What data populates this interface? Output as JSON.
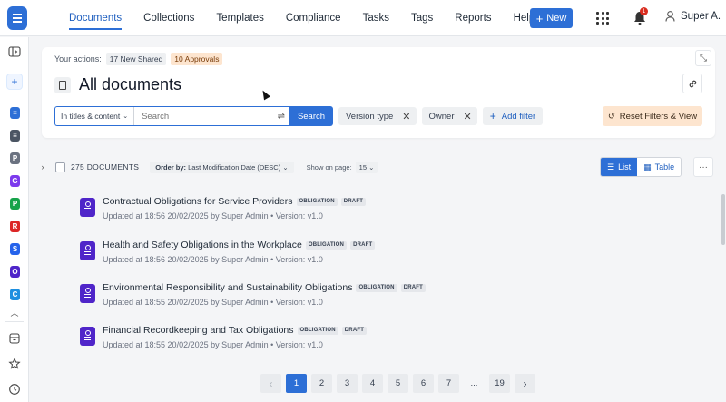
{
  "nav": {
    "items": [
      {
        "label": "Documents",
        "active": true
      },
      {
        "label": "Collections"
      },
      {
        "label": "Templates"
      },
      {
        "label": "Compliance"
      },
      {
        "label": "Tasks"
      },
      {
        "label": "Tags"
      },
      {
        "label": "Reports"
      },
      {
        "label": "Help"
      }
    ],
    "new_label": "New",
    "notification_count": "1",
    "user_name": "Super A."
  },
  "sidebar": {
    "items": [
      {
        "icon": "panel-toggle-icon"
      },
      {
        "icon": "plus-icon"
      },
      {
        "icon": "document-icon",
        "color": "#2d6fd6"
      },
      {
        "icon": "list-doc-icon",
        "color": "#4b5563"
      },
      {
        "letter": "P",
        "color": "#6b7280"
      },
      {
        "letter": "G",
        "color": "#7c3aed"
      },
      {
        "letter": "P",
        "color": "#16a34a"
      },
      {
        "letter": "R",
        "color": "#dc2626"
      },
      {
        "letter": "S",
        "color": "#2563eb"
      },
      {
        "letter": "O",
        "color": "#4f25c9"
      },
      {
        "letter": "C",
        "color": "#1d8fe0"
      }
    ]
  },
  "header": {
    "actions_label": "Your actions:",
    "chip_shared": "17 New Shared",
    "chip_approvals": "10 Approvals",
    "title": "All documents",
    "scope_label": "In titles & content",
    "search_placeholder": "Search",
    "search_button": "Search",
    "filters": [
      "Version type",
      "Owner"
    ],
    "add_filter": "Add filter",
    "reset_label": "Reset Filters & View"
  },
  "listing": {
    "count": "275 DOCUMENTS",
    "order_label": "Order by:",
    "order_value": "Last Modification Date (DESC)",
    "show_label": "Show on page:",
    "per_page": "15",
    "view_list": "List",
    "view_table": "Table",
    "documents": [
      {
        "title": "Contractual Obligations for Service Providers",
        "tags": [
          "OBLIGATION",
          "DRAFT"
        ],
        "meta": "Updated at 18:56 20/02/2025 by Super Admin • Version: v1.0"
      },
      {
        "title": "Health and Safety Obligations in the Workplace",
        "tags": [
          "OBLIGATION",
          "DRAFT"
        ],
        "meta": "Updated at 18:56 20/02/2025 by Super Admin • Version: v1.0"
      },
      {
        "title": "Environmental Responsibility and Sustainability Obligations",
        "tags": [
          "OBLIGATION",
          "DRAFT"
        ],
        "meta": "Updated at 18:55 20/02/2025 by Super Admin • Version: v1.0"
      },
      {
        "title": "Financial Recordkeeping and Tax Obligations",
        "tags": [
          "OBLIGATION",
          "DRAFT"
        ],
        "meta": "Updated at 18:55 20/02/2025 by Super Admin • Version: v1.0"
      }
    ]
  },
  "pagination": {
    "pages": [
      "1",
      "2",
      "3",
      "4",
      "5",
      "6",
      "7",
      "...",
      "19"
    ],
    "current": "1"
  }
}
